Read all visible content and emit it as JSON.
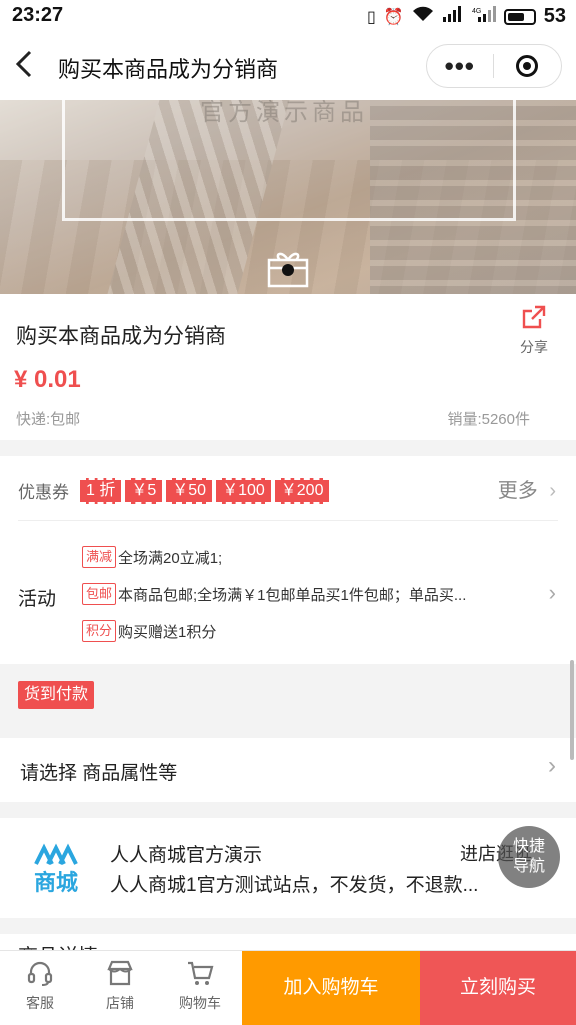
{
  "status": {
    "time": "23:27",
    "battery": "53",
    "network": "4G"
  },
  "header": {
    "title": "购买本商品成为分销商",
    "more_icon": "more-dots-icon",
    "close_icon": "target-icon"
  },
  "banner": {
    "caption": "官方演示商品",
    "gift_icon": "gift-icon"
  },
  "product": {
    "title": "购买本商品成为分销商",
    "share_label": "分享",
    "price": "¥ 0.01",
    "shipping": "快递:包邮",
    "sales": "销量:5260件",
    "accent": "#ef4f4f"
  },
  "coupons": {
    "label": "优惠券",
    "items": [
      "1 折",
      "￥5",
      "￥50",
      "￥100",
      "￥200"
    ],
    "more": "更多"
  },
  "activity": {
    "label": "活动",
    "rows": [
      {
        "tag": "满减",
        "text": "全场满20立减1;"
      },
      {
        "tag": "包邮",
        "text": "本商品包邮;全场满￥1包邮单品买1件包邮；单品买..."
      },
      {
        "tag": "积分",
        "text": "购买赠送1积分"
      }
    ]
  },
  "cod_label": "货到付款",
  "attr_label": "请选择 商品属性等",
  "shop": {
    "logo_text": "商城",
    "name": "人人商城官方演示",
    "desc": "人人商城1官方测试站点，不发货，不退款...",
    "enter": "进店逛逛"
  },
  "fab": {
    "line1": "快捷",
    "line2": "导航"
  },
  "details_label": "商品详情",
  "bottom": {
    "service": "客服",
    "store": "店铺",
    "cart": "购物车",
    "add_cart": "加入购物车",
    "buy_now": "立刻购买",
    "cart_color": "#ff9a00",
    "buy_color": "#ef5656"
  }
}
